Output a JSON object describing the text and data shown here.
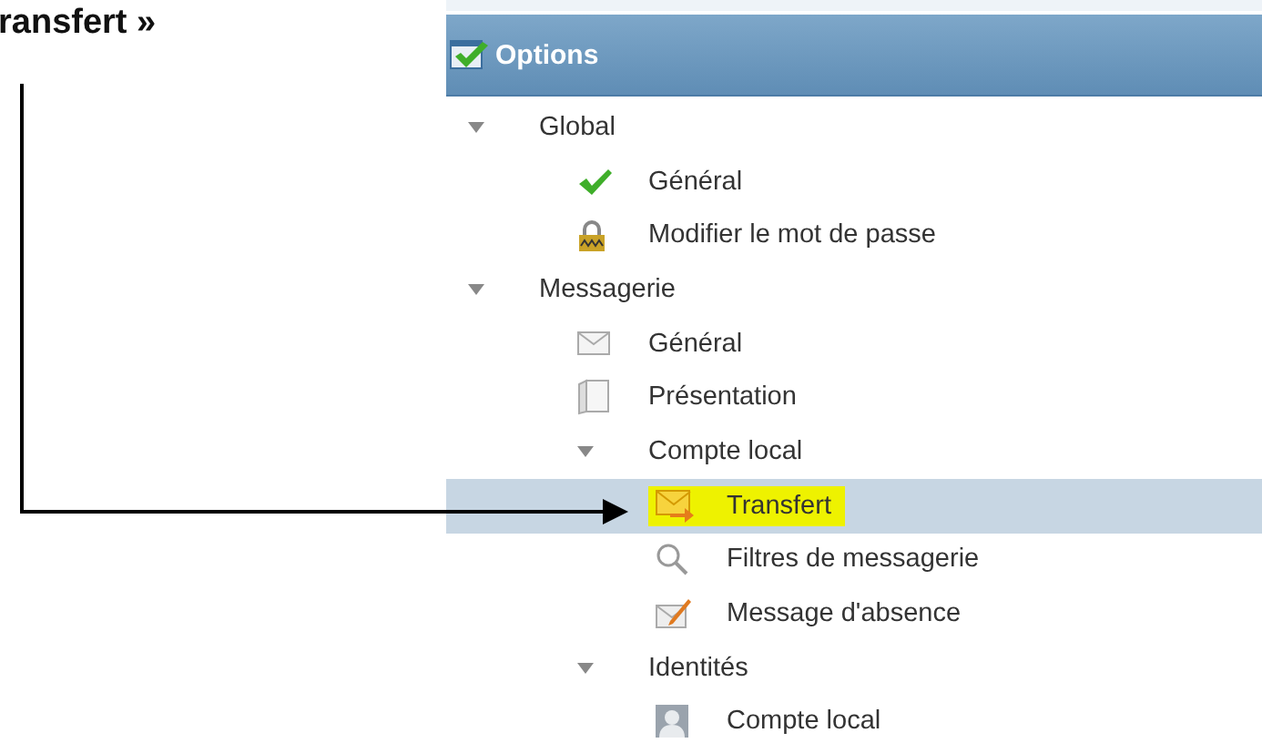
{
  "caption": "ransfert »",
  "panel": {
    "title": "Options"
  },
  "tree": [
    {
      "label": "Global",
      "expanded": true,
      "selected": false,
      "children": [
        {
          "label": "Général",
          "kind": "check",
          "selected": false
        },
        {
          "label": "Modifier le mot de passe",
          "kind": "lock",
          "selected": false
        }
      ]
    },
    {
      "label": "Messagerie",
      "expanded": true,
      "selected": false,
      "children": [
        {
          "label": "Général",
          "kind": "mail",
          "selected": false
        },
        {
          "label": "Présentation",
          "kind": "pages",
          "selected": false
        },
        {
          "label": "Compte local",
          "expanded": true,
          "selected": false,
          "children": [
            {
              "label": "Transfert",
              "kind": "forward",
              "selected": true,
              "highlighted": true
            },
            {
              "label": "Filtres de messagerie",
              "kind": "search",
              "selected": false
            },
            {
              "label": "Message d'absence",
              "kind": "edit",
              "selected": false
            }
          ]
        },
        {
          "label": "Identités",
          "expanded": true,
          "selected": false,
          "children": [
            {
              "label": "Compte local",
              "kind": "person",
              "selected": false
            }
          ]
        }
      ]
    }
  ]
}
